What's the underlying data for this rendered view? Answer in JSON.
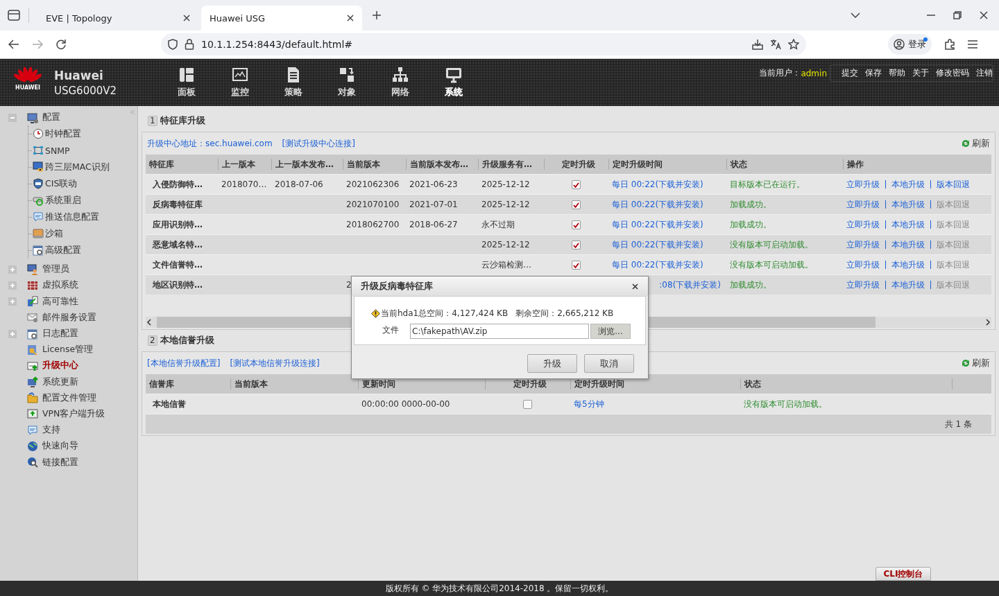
{
  "browser": {
    "tabs": [
      {
        "title": "EVE | Topology",
        "selected": false
      },
      {
        "title": "Huawei USG",
        "selected": true
      }
    ],
    "url": "10.1.1.254:8443/default.html#",
    "profile_button": "登录"
  },
  "header": {
    "logo_text": "HUAWEI",
    "brand": "Huawei",
    "model": "USG6000V2",
    "nav": [
      {
        "kind": "dashboard",
        "label": "面板",
        "selected": false
      },
      {
        "kind": "monitor",
        "label": "监控",
        "selected": false
      },
      {
        "kind": "policy",
        "label": "策略",
        "selected": false
      },
      {
        "kind": "object",
        "label": "对象",
        "selected": false
      },
      {
        "kind": "network",
        "label": "网络",
        "selected": false
      },
      {
        "kind": "system",
        "label": "系统",
        "selected": true
      }
    ],
    "user_label": "当前用户：",
    "user": "admin",
    "menu": [
      "提交",
      "保存",
      "帮助",
      "关于",
      "修改密码",
      "注销"
    ]
  },
  "sidebar": {
    "items": [
      {
        "label": "配置",
        "expanded": true,
        "selected": false,
        "children": [
          {
            "label": "时钟配置",
            "selected": false
          },
          {
            "label": "SNMP",
            "selected": false
          },
          {
            "label": "跨三层MAC识别",
            "selected": false
          },
          {
            "label": "CIS联动",
            "selected": false
          },
          {
            "label": "系统重启",
            "selected": false
          },
          {
            "label": "推送信息配置",
            "selected": false
          },
          {
            "label": "沙箱",
            "selected": false
          },
          {
            "label": "高级配置",
            "selected": false
          }
        ]
      },
      {
        "label": "管理员",
        "expanded": false,
        "selected": false
      },
      {
        "label": "虚拟系统",
        "expanded": false,
        "selected": false
      },
      {
        "label": "高可靠性",
        "expanded": false,
        "selected": false
      },
      {
        "label": "邮件服务设置",
        "selected": false
      },
      {
        "label": "日志配置",
        "expanded": false,
        "selected": false
      },
      {
        "label": "License管理",
        "selected": false
      },
      {
        "label": "升级中心",
        "selected": true
      },
      {
        "label": "系统更新",
        "selected": false
      },
      {
        "label": "配置文件管理",
        "selected": false
      },
      {
        "label": "VPN客户端升级",
        "selected": false
      },
      {
        "label": "支持",
        "selected": false
      },
      {
        "label": "快速向导",
        "selected": false
      },
      {
        "label": "链接配置",
        "selected": false
      }
    ]
  },
  "signature_section": {
    "number": "1",
    "title": "特征库升级",
    "links": [
      "升级中心地址：sec.huawei.com",
      "[测试升级中心连接]"
    ],
    "refresh": "刷新",
    "columns": [
      "特征库",
      "上一版本",
      "上一版本发布…",
      "当前版本",
      "当前版本发布…",
      "升级服务有…",
      "定时升级",
      "定时升级时间",
      "状态",
      "操作"
    ],
    "rows": [
      {
        "name": "入侵防御特…",
        "previous_version": "2018070…",
        "previous_release": "2018-07-06",
        "current_version": "2021062306",
        "current_release": "2021-06-23",
        "service_expiry": "2025-12-12",
        "scheduled": true,
        "schedule": "每日 00:22(下载并安装)",
        "status": "目标版本已在运行。",
        "actions": [
          {
            "label": "立即升级",
            "disabled": false
          },
          {
            "label": "本地升级",
            "disabled": false
          },
          {
            "label": "版本回退",
            "disabled": false
          }
        ]
      },
      {
        "name": "反病毒特征库",
        "current_version": "2021070100",
        "current_release": "2021-07-01",
        "service_expiry": "2025-12-12",
        "scheduled": true,
        "schedule": "每日 00:22(下载并安装)",
        "status": "加载成功。",
        "actions": [
          {
            "label": "立即升级",
            "disabled": false
          },
          {
            "label": "本地升级",
            "disabled": false
          },
          {
            "label": "版本回退",
            "disabled": true
          }
        ]
      },
      {
        "name": "应用识别特…",
        "current_version": "2018062700",
        "current_release": "2018-06-27",
        "service_expiry": "永不过期",
        "scheduled": true,
        "schedule": "每日 00:22(下载并安装)",
        "status": "加载成功。",
        "actions": [
          {
            "label": "立即升级",
            "disabled": false
          },
          {
            "label": "本地升级",
            "disabled": false
          },
          {
            "label": "版本回退",
            "disabled": true
          }
        ]
      },
      {
        "name": "恶意域名特…",
        "service_expiry": "2025-12-12",
        "scheduled": true,
        "schedule": "每日 00:22(下载并安装)",
        "status": "没有版本可启动加载。",
        "actions": [
          {
            "label": "立即升级",
            "disabled": false
          },
          {
            "label": "本地升级",
            "disabled": false
          },
          {
            "label": "版本回退",
            "disabled": true
          }
        ]
      },
      {
        "name": "文件信誉特…",
        "service_expiry": "云沙箱检测…",
        "scheduled": true,
        "schedule": "每日 00:22(下载并安装)",
        "status": "没有版本可启动加载。",
        "actions": [
          {
            "label": "立即升级",
            "disabled": false
          },
          {
            "label": "本地升级",
            "disabled": false
          },
          {
            "label": "版本回退",
            "disabled": true
          }
        ]
      },
      {
        "name": "地区识别特…",
        "current_version_partial": "2",
        "schedule_partial": ":08(下载并安装)",
        "status": "加载成功。",
        "actions": [
          {
            "label": "立即升级",
            "disabled": false
          },
          {
            "label": "本地升级",
            "disabled": false
          },
          {
            "label": "版本回退",
            "disabled": true
          }
        ]
      }
    ]
  },
  "reputation_section": {
    "number": "2",
    "title": "本地信誉升级",
    "links": [
      "[本地信誉升级配置]",
      "[测试本地信誉升级连接]"
    ],
    "refresh": "刷新",
    "columns": [
      "信誉库",
      "当前版本",
      "更新时间",
      "定时升级",
      "定时升级时间",
      "状态"
    ],
    "rows": [
      {
        "name": "本地信誉",
        "update_time": "00:00:00 0000-00-00",
        "scheduled": false,
        "schedule": "每5分钟",
        "status": "没有版本可启动加载。"
      }
    ],
    "footer": "共 1 条"
  },
  "dialog": {
    "title": "升级反病毒特征库",
    "total_space": "当前hda1总空间：4,127,424 KB",
    "free_space": "剩余空间：2,665,212 KB",
    "file_label": "文件",
    "file_value": "C:\\fakepath\\AV.zip",
    "browse_button": "浏览...",
    "buttons": [
      "升级",
      "取消"
    ]
  },
  "footer": {
    "copyright": "版权所有 © 华为技术有限公司2014-2018 。保留一切权利。",
    "cli_button": "CLI控制台"
  }
}
